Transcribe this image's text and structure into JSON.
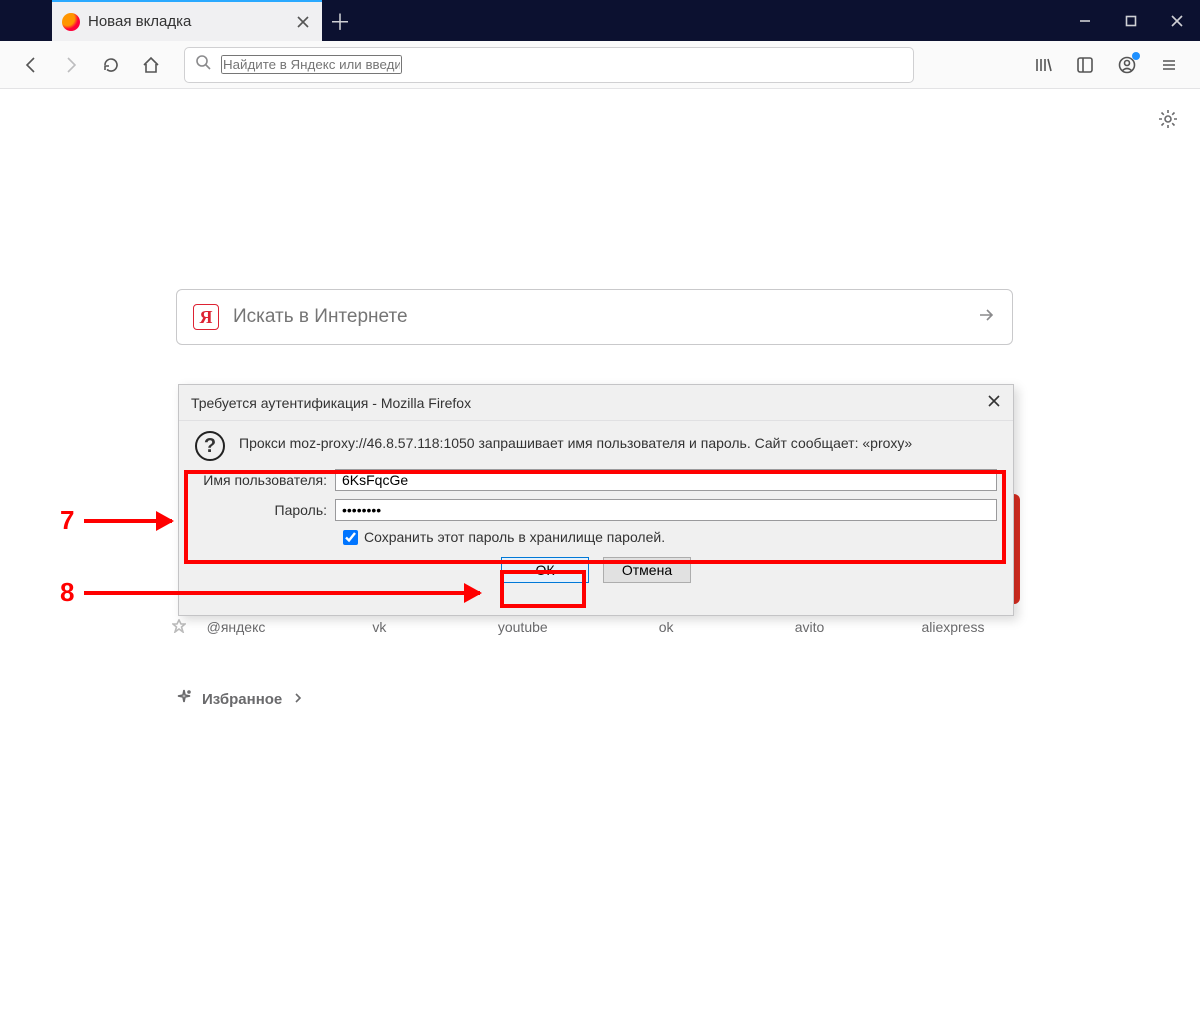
{
  "tab": {
    "title": "Новая вкладка"
  },
  "urlbar": {
    "placeholder": "Найдите в Яндекс или введите адрес"
  },
  "newtab": {
    "yandex_letter": "Я",
    "search_placeholder": "Искать в Интернете",
    "quick_links": [
      "@яндекс",
      "vk",
      "youtube",
      "ok",
      "avito",
      "aliexpress"
    ],
    "favorites_label": "Избранное"
  },
  "dialog": {
    "title": "Требуется аутентификация - Mozilla Firefox",
    "message": "Прокси moz-proxy://46.8.57.118:1050 запрашивает имя пользователя и пароль. Сайт сообщает: «proxy»",
    "username_label": "Имя пользователя:",
    "username_value": "6KsFqcGe",
    "password_label": "Пароль:",
    "password_value": "••••••••",
    "save_checkbox_label": "Сохранить этот пароль в хранилище паролей.",
    "ok_label": "ОК",
    "cancel_label": "Отмена"
  },
  "annotations": {
    "label_7": "7",
    "label_8": "8"
  }
}
